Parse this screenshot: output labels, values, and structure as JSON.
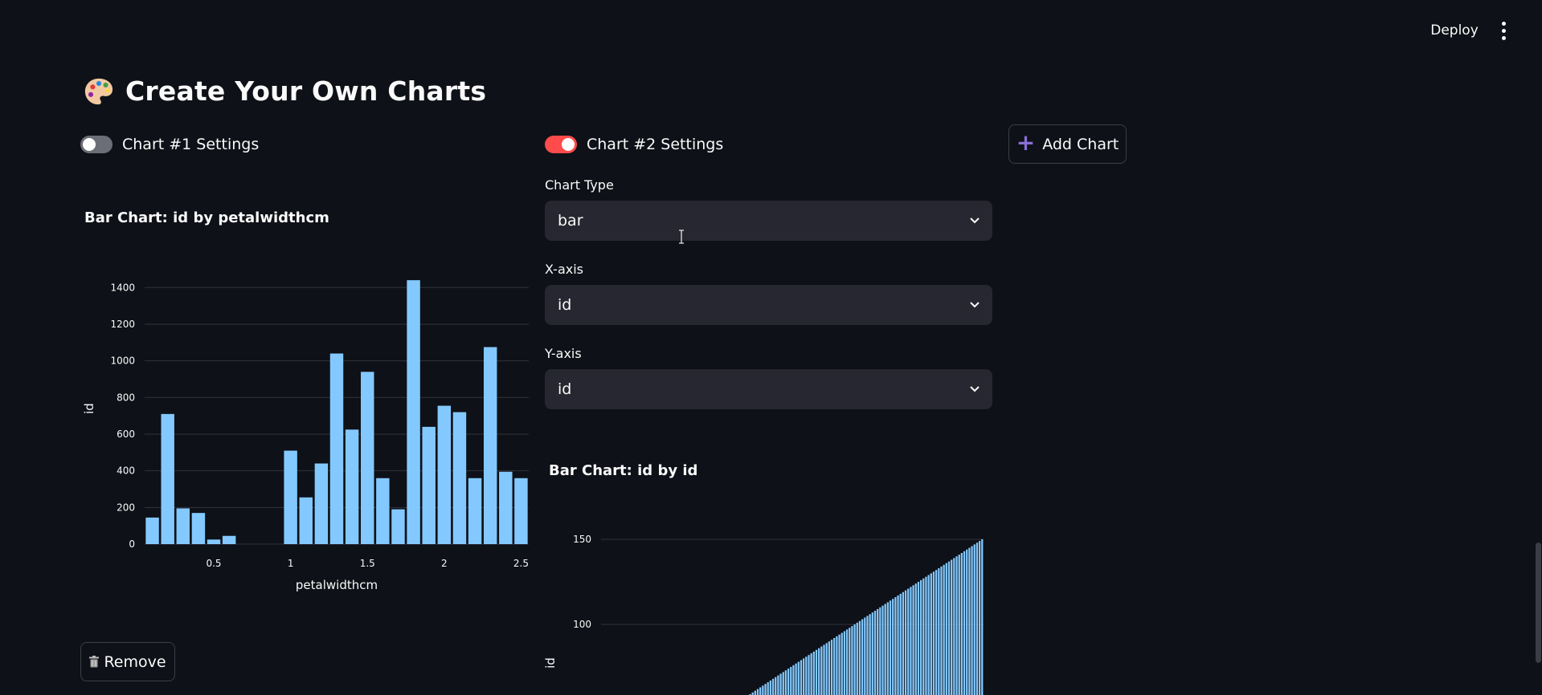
{
  "header": {
    "deploy_label": "Deploy",
    "menu_icon": "kebab-menu-icon"
  },
  "page": {
    "title": "Create Your Own Charts",
    "title_icon": "artist-palette-icon"
  },
  "chart1": {
    "toggle_label": "Chart #1 Settings",
    "toggle_on": false,
    "chart_title": "Bar Chart: id by petalwidthcm",
    "remove_label": "Remove"
  },
  "chart2": {
    "toggle_label": "Chart #2 Settings",
    "toggle_on": true,
    "chart_type_label": "Chart Type",
    "chart_type_value": "bar",
    "x_axis_label": "X-axis",
    "x_axis_value": "id",
    "y_axis_label": "Y-axis",
    "y_axis_value": "id",
    "chart_title": "Bar Chart: id by id"
  },
  "add_chart_label": "Add Chart",
  "colors": {
    "accent": "#ff4b4b",
    "bar": "#83c9ff",
    "background": "#0e1117",
    "select_bg": "#262730"
  },
  "chart_data": [
    {
      "type": "bar",
      "title": "Bar Chart: id by petalwidthcm",
      "xlabel": "petalwidthcm",
      "ylabel": "id",
      "x_ticks": [
        0.5,
        1,
        1.5,
        2,
        2.5
      ],
      "y_ticks": [
        0,
        200,
        400,
        600,
        800,
        1000,
        1200,
        1400
      ],
      "xlim": [
        0.05,
        2.55
      ],
      "ylim": [
        0,
        1480
      ],
      "x": [
        0.1,
        0.2,
        0.3,
        0.4,
        0.5,
        0.6,
        1.0,
        1.1,
        1.2,
        1.3,
        1.4,
        1.5,
        1.6,
        1.7,
        1.8,
        1.9,
        2.0,
        2.1,
        2.2,
        2.3,
        2.4,
        2.5
      ],
      "values": [
        145,
        710,
        195,
        170,
        25,
        45,
        510,
        255,
        440,
        1040,
        625,
        940,
        360,
        190,
        1440,
        640,
        755,
        720,
        360,
        1075,
        395,
        360
      ]
    },
    {
      "type": "bar",
      "title": "Bar Chart: id by id",
      "xlabel": "",
      "ylabel": "id",
      "y_ticks": [
        100,
        150
      ],
      "x": "id 1 to 150",
      "values": "id 1 to 150 (y = x)"
    }
  ]
}
